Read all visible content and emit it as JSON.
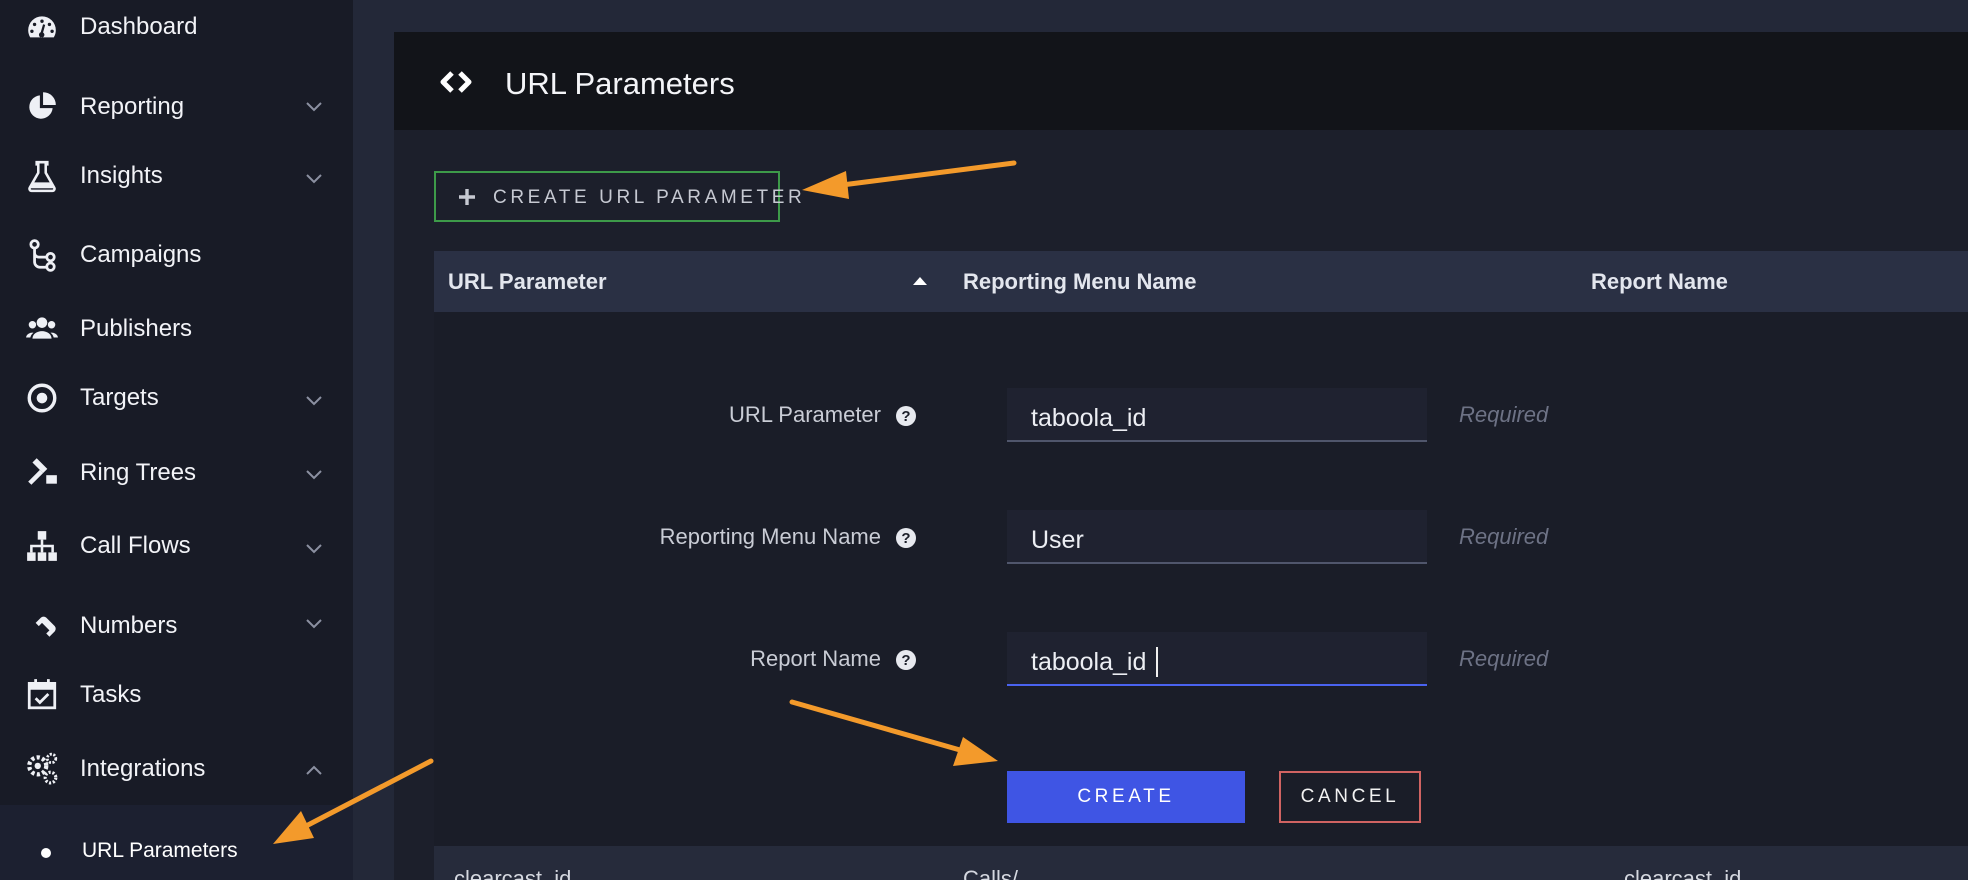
{
  "colors": {
    "accent_blue": "#3f55e4",
    "green_border": "#3d9a49",
    "cancel_border": "#d06362",
    "annotation_orange": "#f39a2b",
    "sidebar_bg": "#181b26"
  },
  "sidebar": {
    "items": [
      {
        "label": "Dashboard",
        "icon": "dashboard-icon",
        "chevron": "none"
      },
      {
        "label": "Reporting",
        "icon": "pie-chart-icon",
        "chevron": "down"
      },
      {
        "label": "Insights",
        "icon": "flask-icon",
        "chevron": "down"
      },
      {
        "label": "Campaigns",
        "icon": "campaign-flow-icon",
        "chevron": "none"
      },
      {
        "label": "Publishers",
        "icon": "users-icon",
        "chevron": "none"
      },
      {
        "label": "Targets",
        "icon": "target-icon",
        "chevron": "down"
      },
      {
        "label": "Ring Trees",
        "icon": "gavel-icon",
        "chevron": "down"
      },
      {
        "label": "Call Flows",
        "icon": "sitemap-icon",
        "chevron": "down"
      },
      {
        "label": "Numbers",
        "icon": "phone-icon",
        "chevron": "down"
      },
      {
        "label": "Tasks",
        "icon": "calendar-check-icon",
        "chevron": "none"
      },
      {
        "label": "Integrations",
        "icon": "gears-icon",
        "chevron": "up"
      }
    ],
    "sub_item": {
      "label": "URL Parameters"
    }
  },
  "header": {
    "title": "URL Parameters",
    "icon": "code-icon"
  },
  "toolbar": {
    "create_label": "CREATE URL PARAMETER"
  },
  "table": {
    "columns": [
      "URL Parameter",
      "Reporting Menu Name",
      "Report Name"
    ],
    "sort": "ascending"
  },
  "form": {
    "fields": [
      {
        "label": "URL Parameter",
        "value": "taboola_id",
        "hint": "Required"
      },
      {
        "label": "Reporting Menu Name",
        "value": "User",
        "hint": "Required"
      },
      {
        "label": "Report Name",
        "value": "taboola_id",
        "hint": "Required"
      }
    ],
    "create_label": "CREATE",
    "cancel_label": "CANCEL"
  },
  "partial_row": [
    "clearcast_id",
    "Calls/...",
    "clearcast_id"
  ]
}
